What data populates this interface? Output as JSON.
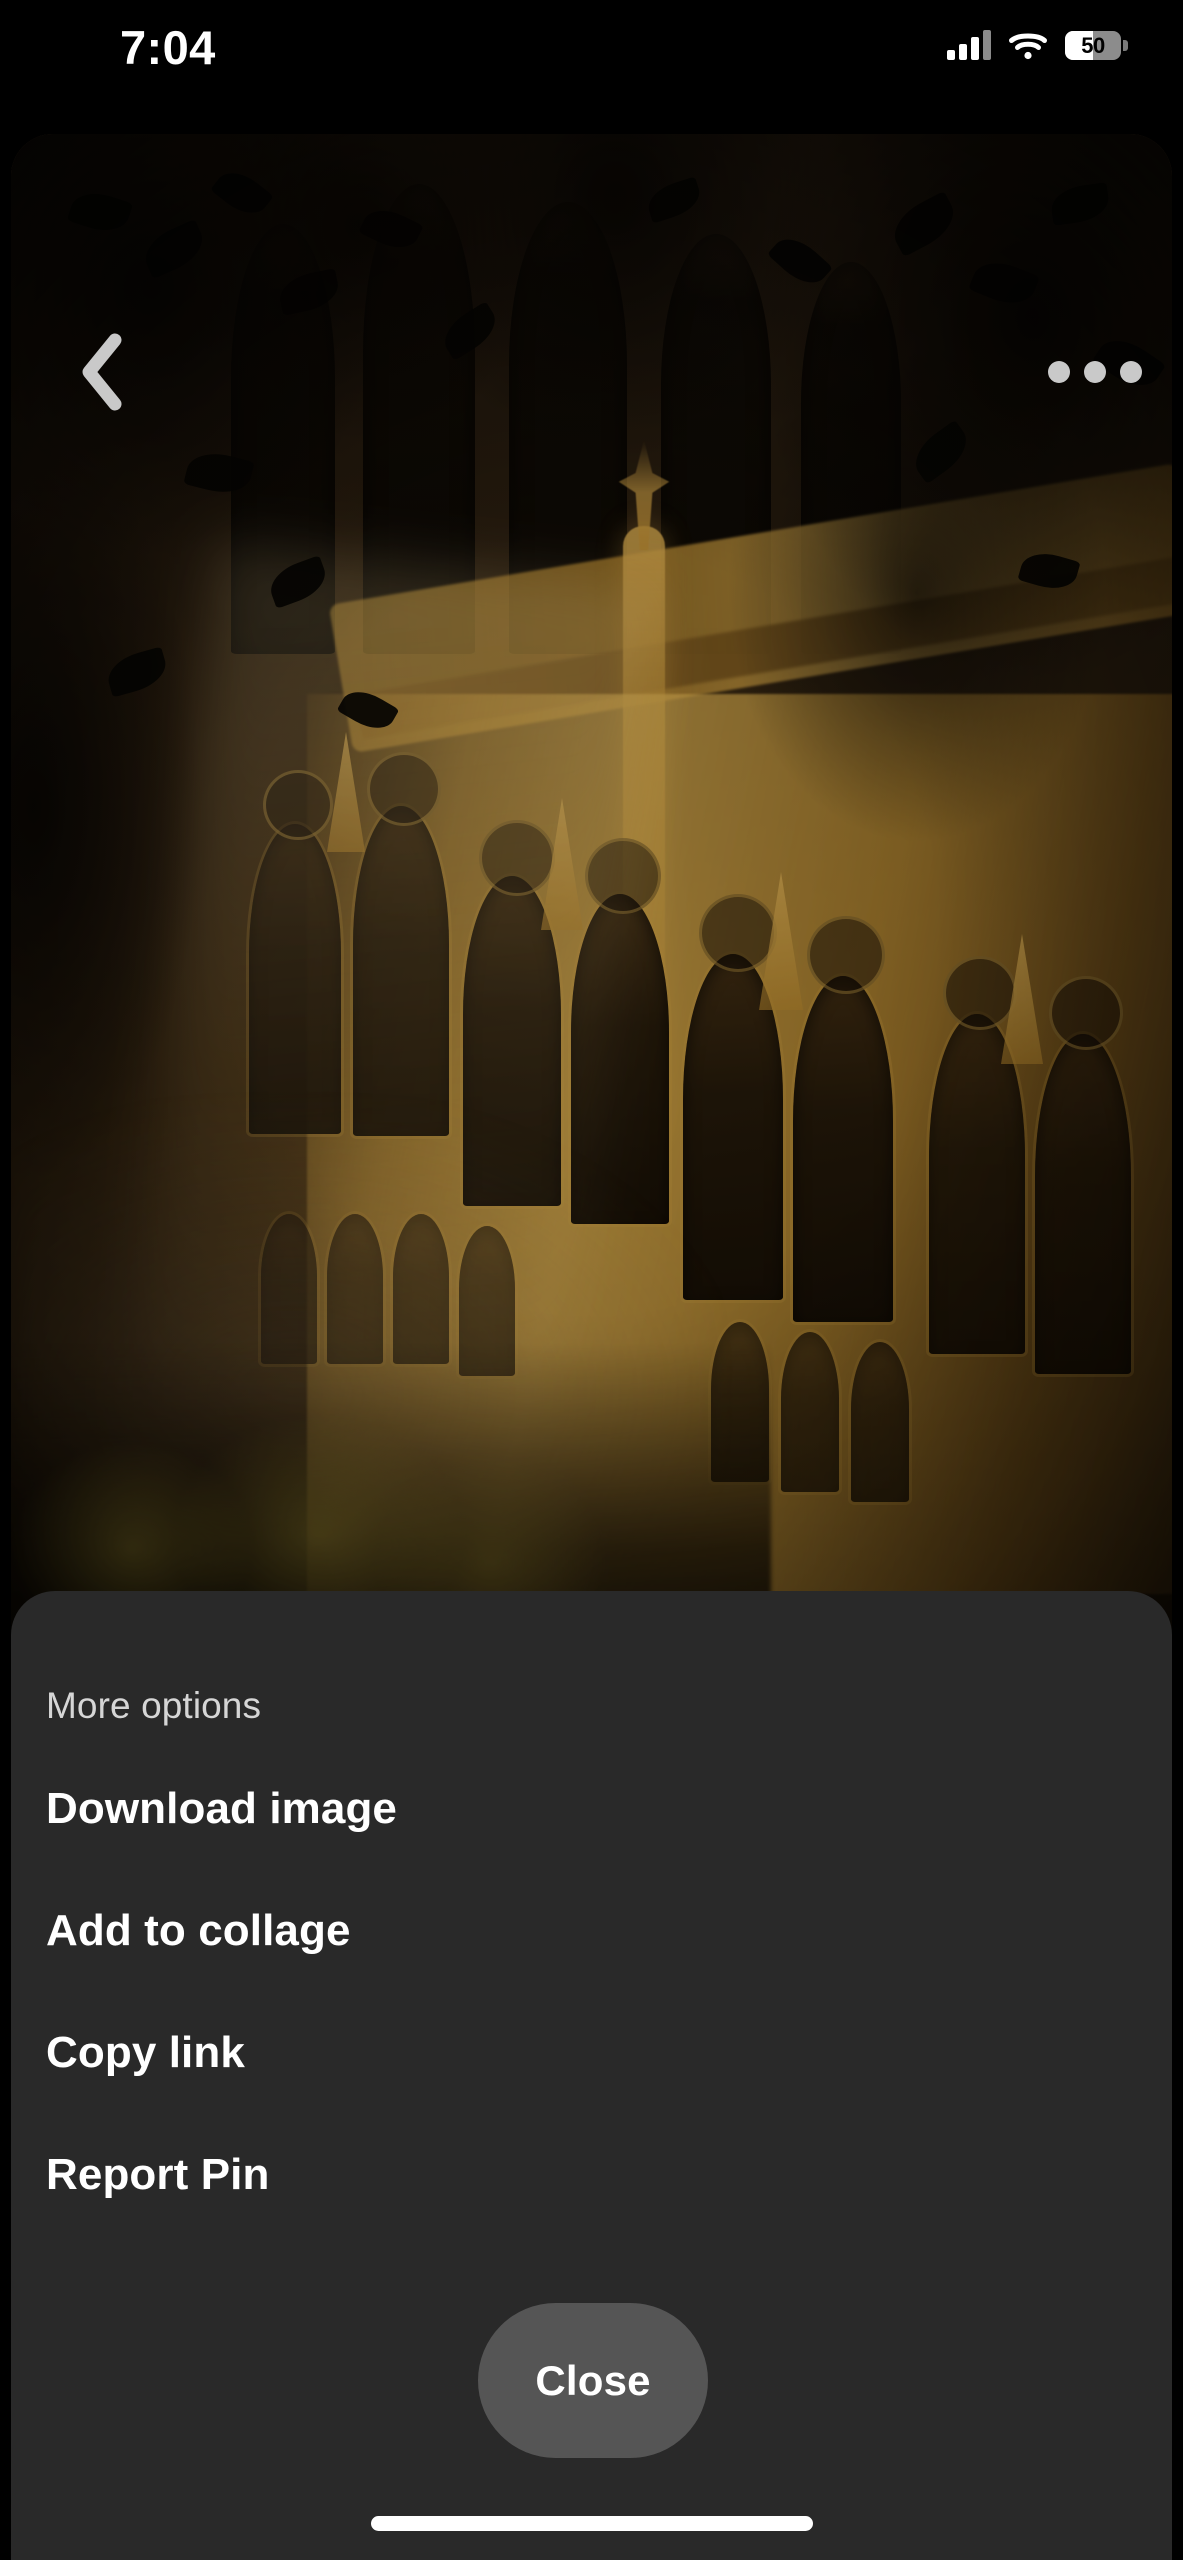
{
  "status_bar": {
    "time": "7:04",
    "cellular_icon": "cellular-signal-icon",
    "wifi_icon": "wifi-icon",
    "battery_icon": "battery-icon",
    "battery_percent": "50",
    "battery_level": 50
  },
  "pin_view": {
    "back_icon": "chevron-left-icon",
    "overflow_icon": "more-horizontal-icon",
    "image_alt": "Gothic cathedral facade illuminated at night with warm amber light, framed by dark tree branches"
  },
  "sheet": {
    "title": "More options",
    "items": [
      {
        "label": "Download image",
        "name": "download-image"
      },
      {
        "label": "Add to collage",
        "name": "add-to-collage"
      },
      {
        "label": "Copy link",
        "name": "copy-link"
      },
      {
        "label": "Report Pin",
        "name": "report-pin"
      }
    ],
    "close_label": "Close"
  },
  "colors": {
    "sheet_background": "#292929",
    "page_background": "#000000",
    "close_button": "#555555",
    "title_text": "#d6d6d6",
    "item_text": "#ffffff",
    "control_icon": "#c9c9c9",
    "home_indicator": "#ffffff"
  }
}
